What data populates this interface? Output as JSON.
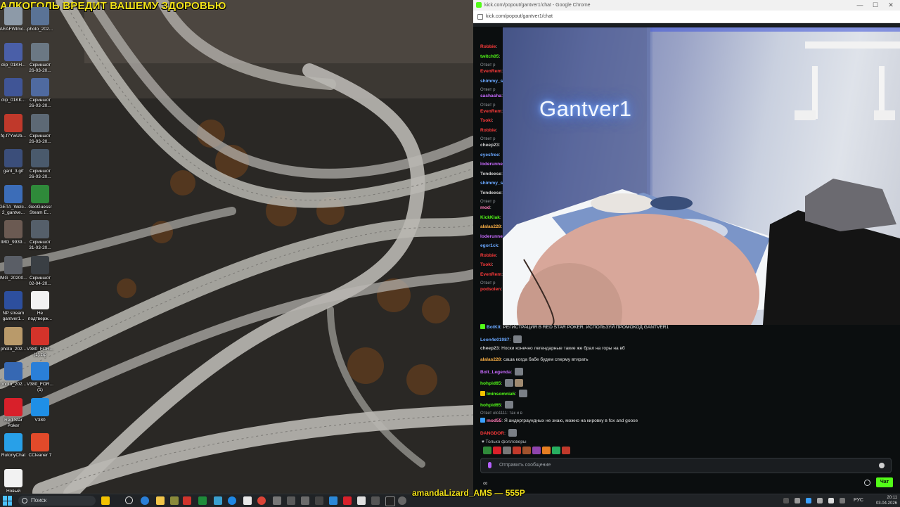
{
  "desktop": {
    "warning_text": "АЛКОГОЛЬ ВРЕДИТ ВАШЕМУ ЗДОРОВЬЮ",
    "icons": [
      {
        "label": "AEAFWtmc...",
        "color": "#8d9aa8"
      },
      {
        "label": "photo_202...",
        "color": "#5a7396"
      },
      {
        "label": "clip_01KH...",
        "color": "#4a5fa8"
      },
      {
        "label": "Скриншот\n26-03-20...",
        "color": "#6b7884"
      },
      {
        "label": "clip_01KK...",
        "color": "#405596"
      },
      {
        "label": "Скриншот\n26-03-20...",
        "color": "#4f6aa0"
      },
      {
        "label": "fq-f7YwUb...",
        "color": "#c0392b"
      },
      {
        "label": "Скриншот\n26-03-20...",
        "color": "#5d6975"
      },
      {
        "label": "gant_3.gif",
        "color": "#3b4e7a"
      },
      {
        "label": "Скриншот\n26-03-20...",
        "color": "#4a5a6c"
      },
      {
        "label": "GETA_Welc...\n2_gantve...",
        "color": "#3c6db8"
      },
      {
        "label": "GeoGuessr\nSteam E...",
        "color": "#2f8a3a"
      },
      {
        "label": "IMG_9939...",
        "color": "#6b5a52"
      },
      {
        "label": "Скриншот\n31-03-20...",
        "color": "#555f6a"
      },
      {
        "label": "IMG_20200...",
        "color": "#5a5e66"
      },
      {
        "label": "Скриншот\n02-04-20...",
        "color": "#3a3f44"
      },
      {
        "label": "NP stream\ngantver1...",
        "color": "#2d4f9e"
      },
      {
        "label": "Не\nподтверж...",
        "color": "#f2f2f2"
      },
      {
        "label": "photo_202...",
        "color": "#b99a6a"
      },
      {
        "label": "V380_FOR...\n(1).zip",
        "color": "#d4332a"
      },
      {
        "label": "photo_202...",
        "color": "#3668b3"
      },
      {
        "label": "V380_FOR...\n(1)",
        "color": "#2a7fd8"
      },
      {
        "label": "Red Star\nPoker",
        "color": "#d8202a"
      },
      {
        "label": "V380",
        "color": "#1f8fe6"
      },
      {
        "label": "RutonyChat",
        "color": "#28a0e8"
      },
      {
        "label": "CCleaner 7",
        "color": "#e24a2a"
      },
      {
        "label": "Новый\nтекстовый ...",
        "color": "#f2f2f2"
      }
    ]
  },
  "taskbar": {
    "search_placeholder": "Поиск",
    "lang": "РУС",
    "time": "20:11",
    "date": "03.04.2026"
  },
  "ticker_text": "amandaLizard_AMS — 555Р",
  "browser": {
    "title": "kick.com/popout/gantver1/chat - Google Chrome",
    "url": "kick.com/popout/gantver1/chat",
    "min_glyph": "—",
    "max_glyph": "☐",
    "close_glyph": "✕"
  },
  "video": {
    "neon_sign": "Gantver1"
  },
  "chat": {
    "left_column": [
      {
        "kind": "msg",
        "user": "Robbie",
        "color": "#ff3b3b",
        "text": ""
      },
      {
        "kind": "msg",
        "user": "twitch05",
        "color": "#53fc18",
        "text": ""
      },
      {
        "kind": "reply",
        "text": "Ответ р"
      },
      {
        "kind": "msg",
        "user": "EvenRem",
        "color": "#ff3b3b",
        "text": ""
      },
      {
        "kind": "msg",
        "user": "shimmy_s",
        "color": "#6aa8ff",
        "text": ""
      },
      {
        "kind": "reply",
        "text": "Ответ р"
      },
      {
        "kind": "msg",
        "user": "sashasha",
        "color": "#c86bff",
        "text": ""
      },
      {
        "kind": "reply",
        "text": "Ответ р"
      },
      {
        "kind": "msg",
        "user": "EvenRem",
        "color": "#ff3b3b",
        "text": ""
      },
      {
        "kind": "msg",
        "user": "Tsoki",
        "color": "#ff3b3b",
        "text": ""
      },
      {
        "kind": "msg",
        "user": "Robbie",
        "color": "#ff3b3b",
        "text": ""
      },
      {
        "kind": "reply",
        "text": "Ответ р"
      },
      {
        "kind": "msg",
        "user": "cheep23",
        "color": "#d0d0d0",
        "text": ""
      },
      {
        "kind": "msg",
        "user": "eyesfree",
        "color": "#6aa8ff",
        "text": ""
      },
      {
        "kind": "msg",
        "user": "loderunne",
        "color": "#c86bff",
        "text": ""
      },
      {
        "kind": "msg",
        "user": "Tendeese",
        "color": "#d0d0d0",
        "text": ""
      },
      {
        "kind": "msg",
        "user": "shimmy_s",
        "color": "#6aa8ff",
        "text": ""
      },
      {
        "kind": "msg",
        "user": "Tendeese",
        "color": "#d0d0d0",
        "text": ""
      },
      {
        "kind": "reply",
        "text": "Ответ р"
      },
      {
        "kind": "msg",
        "user": "mod",
        "color": "#ff7ab6",
        "text": ""
      },
      {
        "kind": "msg",
        "user": "KickKlak",
        "color": "#53fc18",
        "text": ""
      },
      {
        "kind": "msg",
        "user": "alalas228",
        "color": "#ffb347",
        "text": ""
      },
      {
        "kind": "msg",
        "user": "loderunne",
        "color": "#c86bff",
        "text": ""
      },
      {
        "kind": "msg",
        "user": "egor1ck",
        "color": "#6aa8ff",
        "text": ""
      },
      {
        "kind": "msg",
        "user": "Robbie",
        "color": "#ff3b3b",
        "text": ""
      },
      {
        "kind": "msg",
        "user": "Tsoki",
        "color": "#ff3b3b",
        "text": ""
      },
      {
        "kind": "msg",
        "user": "EvenRem",
        "color": "#ff3b3b",
        "text": ""
      },
      {
        "kind": "reply",
        "text": "Ответ р"
      },
      {
        "kind": "msg",
        "user": "podsolen",
        "color": "#ff3b3b",
        "text": ""
      }
    ],
    "full_messages": [
      {
        "kind": "msg",
        "user": "BotKit",
        "color": "#6aa8ff",
        "text": "РЕГИСТРАЦИЯ В RED STAR POKER. ИСПОЛЬЗУЙ ПРОМОКОД GANTVER1",
        "badge_color": "#53fc18"
      },
      {
        "kind": "msg",
        "user": "Leon4e01987",
        "color": "#6aa8ff",
        "text": "",
        "emotes": 1
      },
      {
        "kind": "msg",
        "user": "cheep23",
        "color": "#d0d0d0",
        "text": "Носки конечно легендарные такие же брал на горы на вб"
      },
      {
        "kind": "msg",
        "user": "alalas228",
        "color": "#ffb347",
        "text": "саша когда бабе будем сперму втирать"
      },
      {
        "kind": "msg",
        "user": "Bolt_Legenda",
        "color": "#c86bff",
        "text": "",
        "emotes": 1
      },
      {
        "kind": "msg",
        "user": "hohpid65",
        "color": "#53fc18",
        "text": "",
        "emotes": 2
      },
      {
        "kind": "msg",
        "user": "Iminsomnia5",
        "color": "#53fc18",
        "text": "",
        "emotes": 1,
        "badge_color": "#f2c200"
      },
      {
        "kind": "msg",
        "user": "hohpid65",
        "color": "#53fc18",
        "text": "",
        "emotes": 1
      },
      {
        "kind": "reply",
        "text": "Ответ elo1111: так и в"
      },
      {
        "kind": "msg",
        "user": "mod55",
        "color": "#ff7ab6",
        "text": "Я андерграундных не знаю, можно на кировку в fox and goose",
        "badge_color": "#3aa0ff"
      },
      {
        "kind": "msg",
        "user": "DANGDOR",
        "color": "#ff3b3b",
        "text": "",
        "emotes": 1
      }
    ],
    "followers_only": "Только фолловеры",
    "input_placeholder": "Отправить сообщение",
    "send_label": "Чат",
    "infinity_glyph": "∞"
  }
}
